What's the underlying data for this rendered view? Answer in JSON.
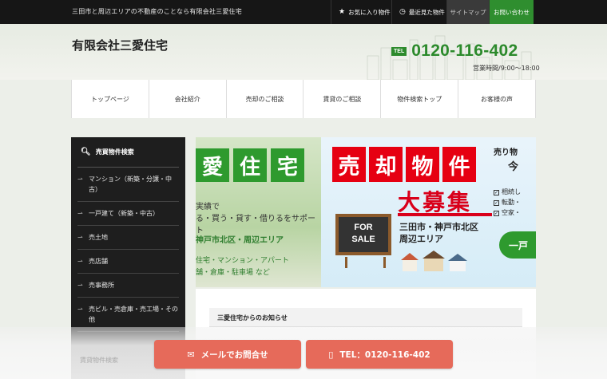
{
  "topbar": {
    "tagline": "三田市と周辺エリアの不動産のことなら有限会社三愛住宅",
    "links": {
      "favorites": "お気に入り物件",
      "recent": "最近見た物件",
      "sitemap": "サイトマップ",
      "contact": "お問い合わせ"
    }
  },
  "header": {
    "company": "有限会社三愛住宅",
    "tel_badge": "TEL",
    "tel_number": "0120-116-402",
    "hours": "営業時間/9:00～18:00"
  },
  "nav": [
    "トップページ",
    "会社紹介",
    "売却のご相談",
    "賃貸のご相談",
    "物件検索トップ",
    "お客様の声"
  ],
  "sidebar": {
    "title": "売買物件検索",
    "items": [
      "マンション（新築・分譲・中古）",
      "一戸建て（新築・中古）",
      "売土地",
      "売店舗",
      "売事務所",
      "売ビル・売倉庫・売工場・その他"
    ],
    "faded_item": "賃貸物件検索"
  },
  "banner": {
    "left_title": [
      "愛",
      "住",
      "宅"
    ],
    "left_line1": "実績で",
    "left_line2": "る・買う・貸す・借りるをサポート",
    "left_area": "神戸市北区・周辺エリア",
    "left_types1": "住宅・マンション・アパート",
    "left_types2": "舗・倉庫・駐車場 など",
    "sell_chars": [
      "売",
      "却",
      "物",
      "件"
    ],
    "boshu": "大募集",
    "area_line1": "三田市・神戸市北区",
    "area_line2": "周辺エリア",
    "chalk_line1": "FOR",
    "chalk_line2": "SALE",
    "right_top1": "売り物",
    "right_top2": "今",
    "checks": [
      "相続し",
      "転勤・",
      "空家・"
    ],
    "pill": "一戸"
  },
  "slider": {
    "count": 3,
    "active": 1
  },
  "news": {
    "title": "三愛住宅からのお知らせ"
  },
  "footer_buttons": {
    "mail": "メールでお問合せ",
    "tel": "TEL：0120-116-402"
  },
  "colors": {
    "accent_green": "#2c8a2c",
    "accent_red": "#e66a5a",
    "banner_red": "#e60012"
  }
}
